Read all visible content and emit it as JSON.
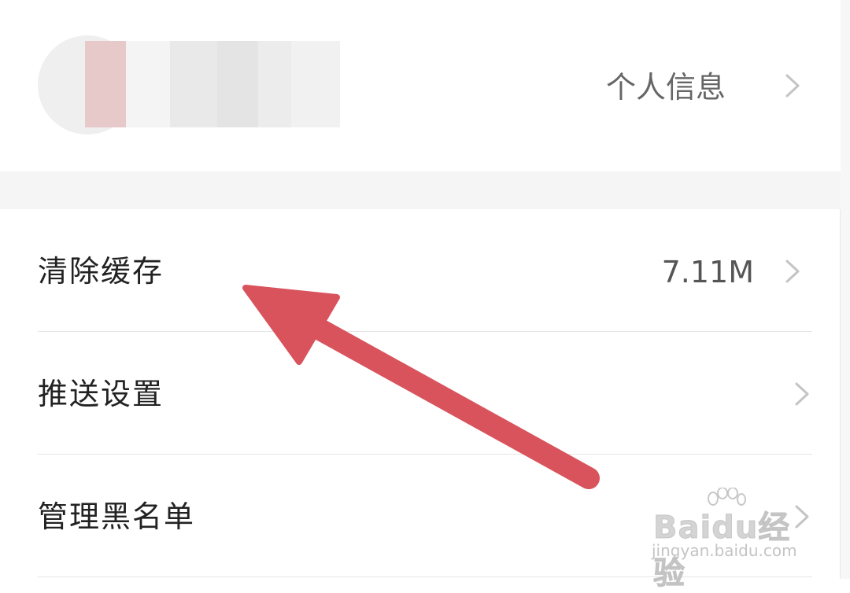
{
  "profile": {
    "label": "个人信息",
    "chevron_icon": "chevron-right-icon"
  },
  "settings": [
    {
      "label": "清除缓存",
      "value": "7.11M"
    },
    {
      "label": "推送设置",
      "value": ""
    },
    {
      "label": "管理黑名单",
      "value": ""
    }
  ],
  "watermark": {
    "logo_text": "Baidu经验",
    "url": "jingyan.baidu.com"
  },
  "colors": {
    "arrow": "#d9535c",
    "primary_text": "#222222",
    "secondary_text": "#666666",
    "chevron": "#c4c4c4",
    "section_gap": "#f5f5f5"
  }
}
